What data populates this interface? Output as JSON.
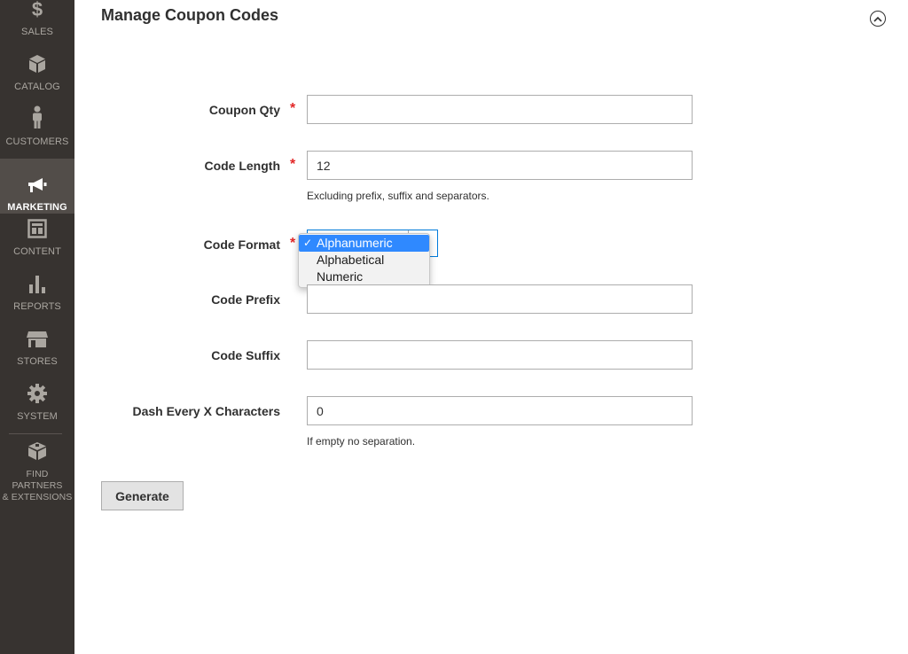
{
  "sidebar": {
    "items": [
      {
        "label": "SALES",
        "icon": "dollar-icon",
        "active": false
      },
      {
        "label": "CATALOG",
        "icon": "cube-icon",
        "active": false
      },
      {
        "label": "CUSTOMERS",
        "icon": "person-icon",
        "active": false
      },
      {
        "label": "MARKETING",
        "icon": "megaphone-icon",
        "active": true
      },
      {
        "label": "CONTENT",
        "icon": "layout-icon",
        "active": false
      },
      {
        "label": "REPORTS",
        "icon": "bar-chart-icon",
        "active": false
      },
      {
        "label": "STORES",
        "icon": "storefront-icon",
        "active": false
      },
      {
        "label": "SYSTEM",
        "icon": "gear-icon",
        "active": false
      }
    ],
    "partners": {
      "line1": "FIND PARTNERS",
      "line2": "& EXTENSIONS",
      "icon": "box-icon"
    }
  },
  "section": {
    "title": "Manage Coupon Codes",
    "collapse_icon": "chevron-up-circle-icon"
  },
  "form": {
    "required_marker": "*",
    "coupon_qty": {
      "label": "Coupon Qty",
      "value": ""
    },
    "code_length": {
      "label": "Code Length",
      "value": "12",
      "note": "Excluding prefix, suffix and separators."
    },
    "code_format": {
      "label": "Code Format",
      "options": [
        "Alphanumeric",
        "Alphabetical",
        "Numeric"
      ],
      "selected": "Alphanumeric",
      "check": "✓"
    },
    "code_prefix": {
      "label": "Code Prefix",
      "value": ""
    },
    "code_suffix": {
      "label": "Code Suffix",
      "value": ""
    },
    "dash_every": {
      "label": "Dash Every X Characters",
      "value": "0",
      "note": "If empty no separation."
    },
    "generate_label": "Generate"
  },
  "colors": {
    "sidebar_bg": "#373330",
    "sidebar_active": "#524d49",
    "required_star": "#e22626",
    "focus_border": "#007bdb",
    "dropdown_highlight": "#2f89ff"
  }
}
